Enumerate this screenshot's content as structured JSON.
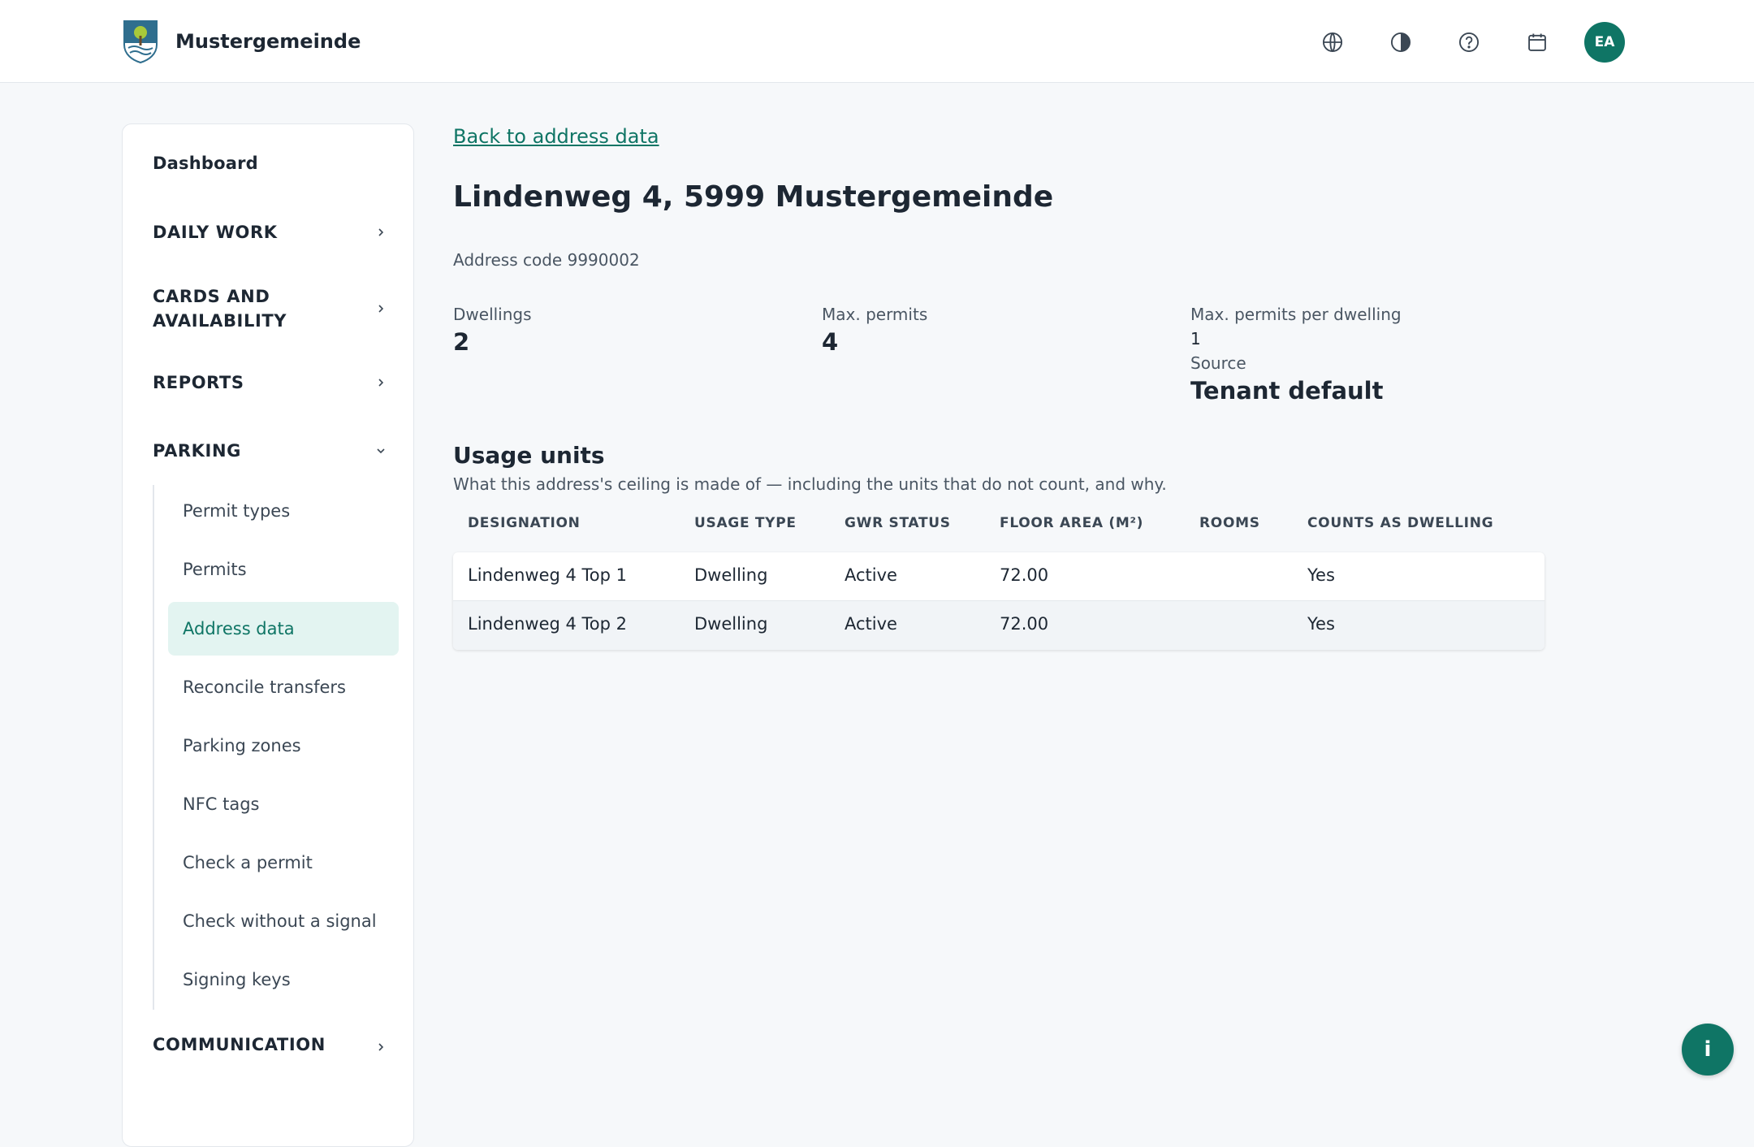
{
  "app": {
    "name": "Mustergemeinde",
    "accent_color": "#0f7565",
    "logo_icon": "municipal-crest-tree"
  },
  "header": {
    "actions": [
      {
        "icon": "globe-icon"
      },
      {
        "icon": "contrast-icon"
      },
      {
        "icon": "help-icon"
      },
      {
        "icon": "calendar-icon"
      }
    ],
    "avatar_initials": "EA"
  },
  "sidebar": {
    "dashboard": "Dashboard",
    "sections": [
      {
        "label": "DAILY WORK",
        "expanded": false
      },
      {
        "label": "CARDS AND AVAILABILITY",
        "expanded": false
      },
      {
        "label": "REPORTS",
        "expanded": false
      },
      {
        "label": "PARKING",
        "expanded": true
      },
      {
        "label": "COMMUNICATION",
        "expanded": false
      }
    ],
    "parking_items": [
      {
        "label": "Permit types"
      },
      {
        "label": "Permits"
      },
      {
        "label": "Address data",
        "active": true
      },
      {
        "label": "Reconcile transfers"
      },
      {
        "label": "Parking zones"
      },
      {
        "label": "NFC tags"
      },
      {
        "label": "Check a permit"
      },
      {
        "label": "Check without a signal"
      },
      {
        "label": "Signing keys"
      }
    ]
  },
  "main": {
    "back_link": "Back to address data",
    "title": "Lindenweg 4, 5999 Mustergemeinde",
    "address_code": "Address code 9990002",
    "stats": {
      "dwellings_label": "Dwellings",
      "dwellings_value": "2",
      "max_permits_label": "Max. permits",
      "max_permits_value": "4",
      "per_dwelling_label": "Max. permits per dwelling",
      "per_dwelling_value": "1",
      "source_label": "Source",
      "source_value": "Tenant default"
    },
    "usage_units": {
      "title": "Usage units",
      "description": "What this address's ceiling is made of — including the units that do not count, and why.",
      "columns": [
        "DESIGNATION",
        "USAGE TYPE",
        "GWR STATUS",
        "FLOOR AREA (M²)",
        "ROOMS",
        "COUNTS AS DWELLING"
      ],
      "rows": [
        {
          "designation": "Lindenweg 4 Top 1",
          "usage_type": "Dwelling",
          "gwr_status": "Active",
          "floor_area": "72.00",
          "rooms": "",
          "counts": "Yes"
        },
        {
          "designation": "Lindenweg 4 Top 2",
          "usage_type": "Dwelling",
          "gwr_status": "Active",
          "floor_area": "72.00",
          "rooms": "",
          "counts": "Yes"
        }
      ]
    }
  },
  "fab": {
    "label": "i",
    "icon": "info-icon"
  }
}
